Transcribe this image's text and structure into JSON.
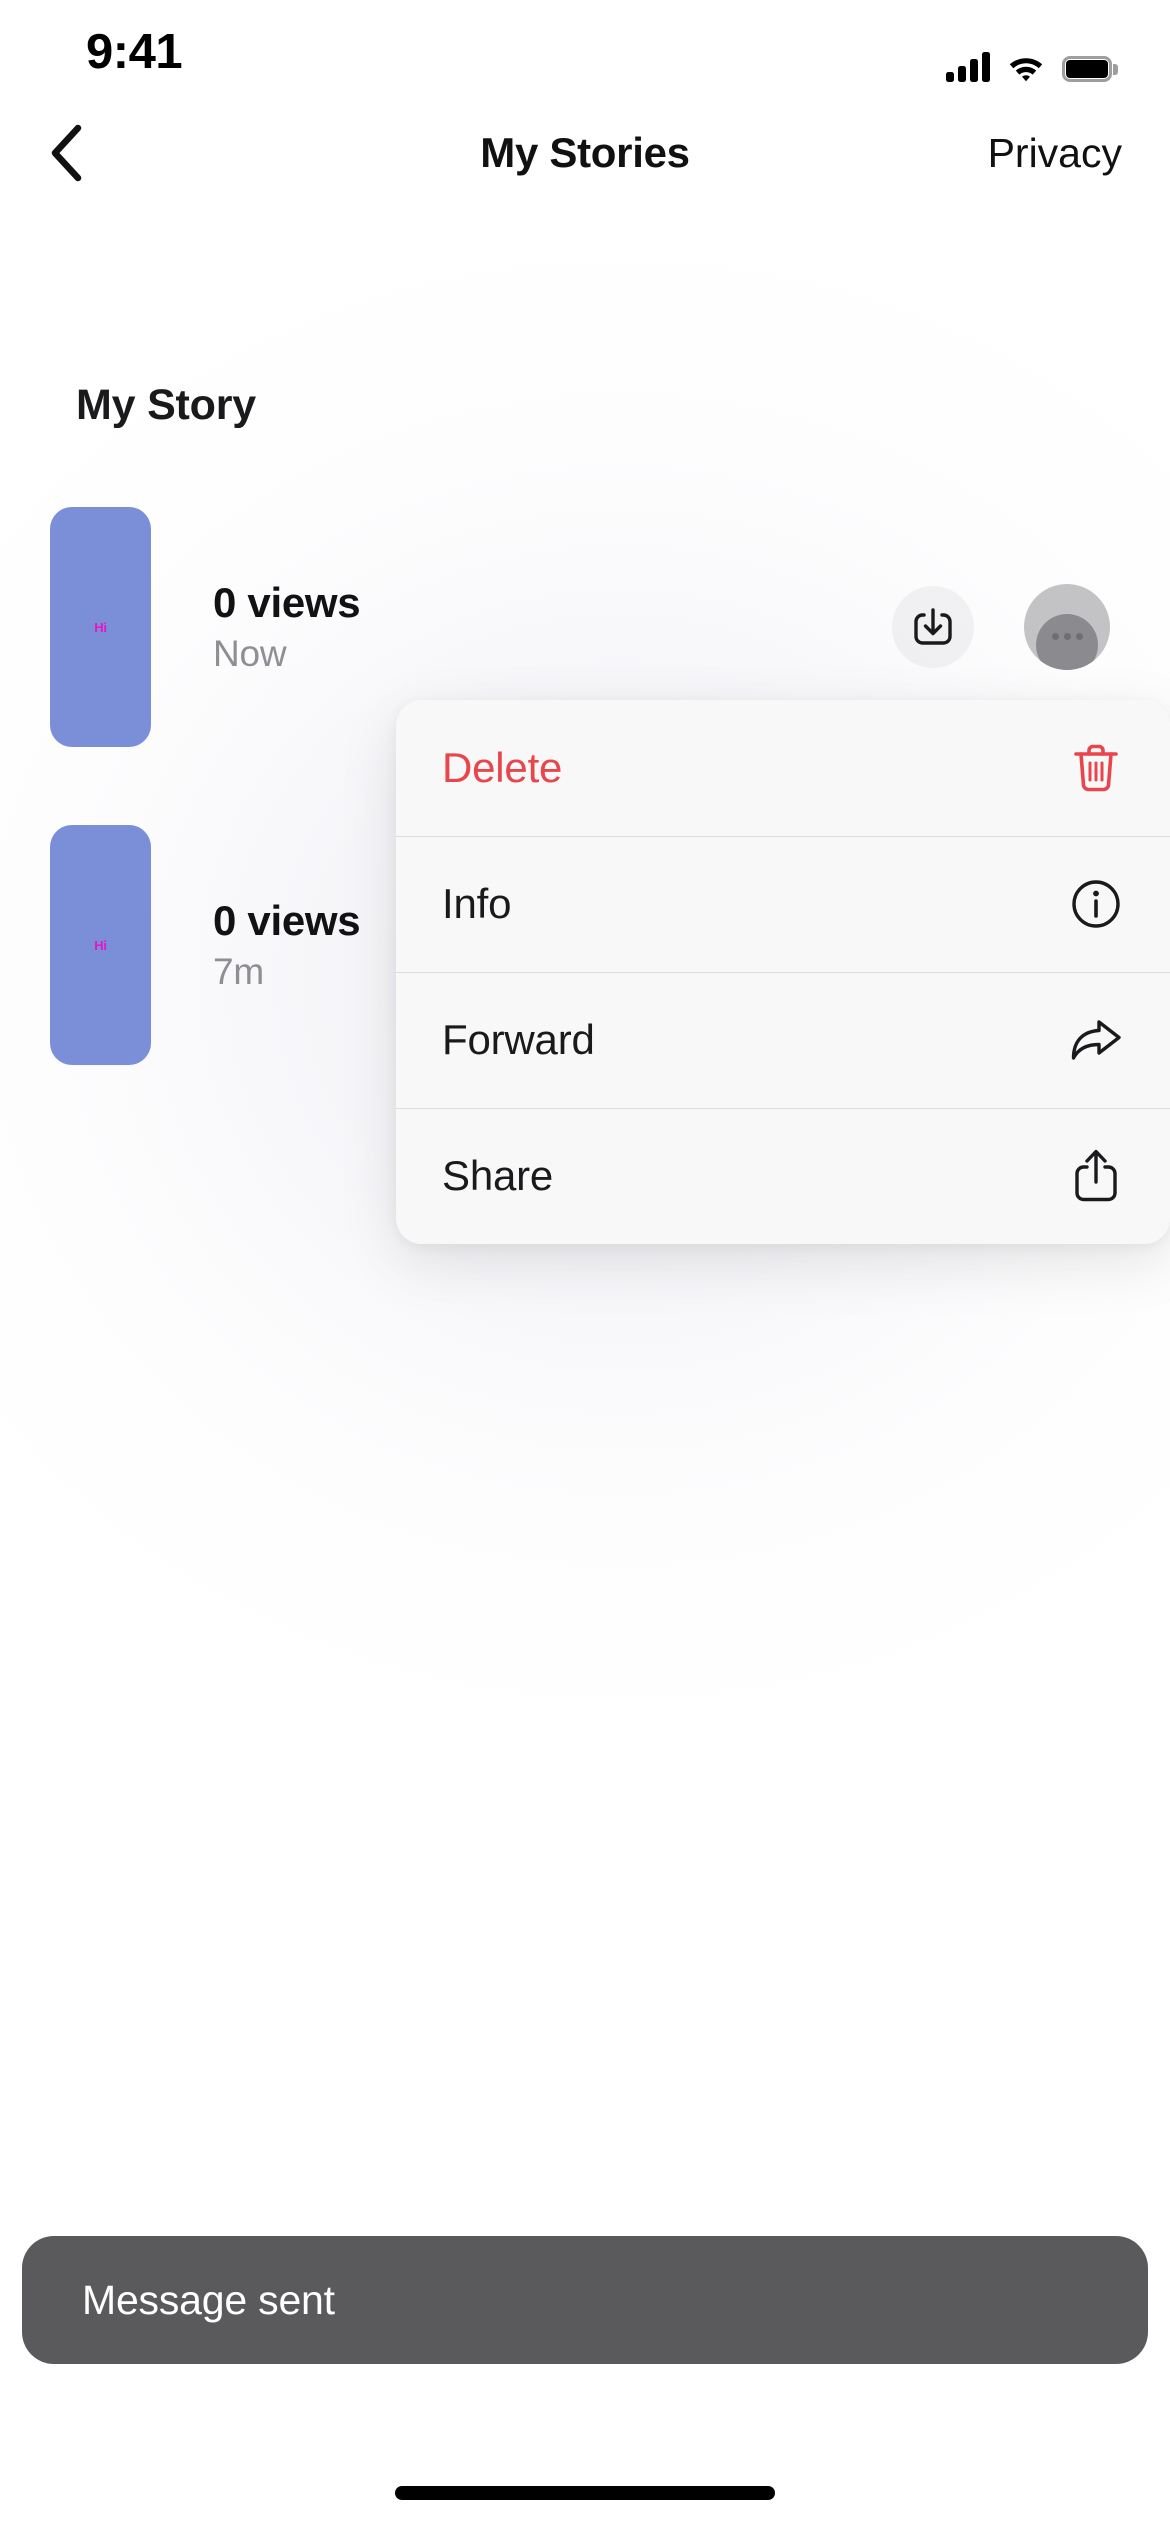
{
  "status_bar": {
    "time": "9:41",
    "signal_icon": "cellular-signal-icon",
    "wifi_icon": "wifi-icon",
    "battery_icon": "battery-full-icon"
  },
  "nav_bar": {
    "back_icon": "chevron-left-icon",
    "title": "My Stories",
    "privacy_label": "Privacy"
  },
  "main": {
    "section_title": "My Story",
    "stories": [
      {
        "thumbnail_text": "Hi",
        "views": "0 views",
        "time": "Now",
        "download_icon": "download-icon",
        "avatar_icon": "avatar-placeholder-icon"
      },
      {
        "thumbnail_text": "Hi",
        "views": "0 views",
        "time": "7m"
      }
    ]
  },
  "context_menu": {
    "items": [
      {
        "label": "Delete",
        "icon": "trash-icon",
        "destructive": true
      },
      {
        "label": "Info",
        "icon": "info-circle-icon",
        "destructive": false
      },
      {
        "label": "Forward",
        "icon": "forward-arrow-icon",
        "destructive": false
      },
      {
        "label": "Share",
        "icon": "share-icon",
        "destructive": false
      }
    ]
  },
  "toast": {
    "message": "Message sent"
  },
  "colors": {
    "destructive": "#e8454c",
    "thumbnail": "#7b8ed8",
    "thumbnail_text": "#e913c8",
    "secondary_text": "#8e8e93",
    "toast_background": "#5a5a5c"
  }
}
